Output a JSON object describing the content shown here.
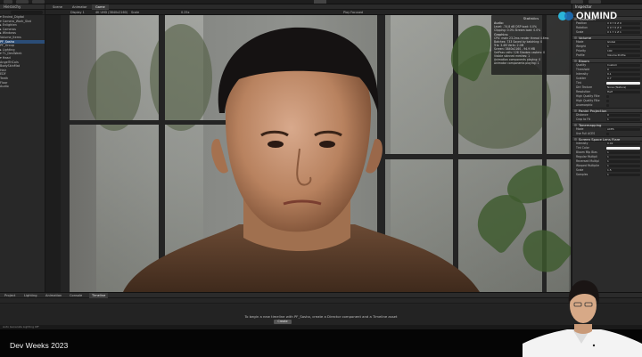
{
  "hierarchy": {
    "tab": "Hierarchy",
    "items": [
      "▾ Enviroi_Digital",
      "  ▾ Camera_Work_Stat",
      "  ▸ Enlighten",
      "  ▸ Cameras",
      "  ▸ Windows",
      "    Volume_Items",
      "    PF_Sasha",
      "    PF_Group",
      "  ▸ Lighting",
      "  ▾ TL_DevWeek",
      "    ▾ Head",
      "      AngelTriCols",
      "      BodySkinMat",
      "      Hair",
      "      EDF",
      "      Teeth",
      "    Floor",
      "    Audio"
    ]
  },
  "view_tabs": [
    "Scene",
    "Animator",
    "Game"
  ],
  "gamebar": {
    "display": "Display 1",
    "aspect": "4K UHD (3840x2160)",
    "scale": "Scale",
    "scale_value": "0.25x",
    "mode": "Play Focused"
  },
  "stats": {
    "title": "Statistics",
    "audio_h": "Audio:",
    "audio_lines": [
      "Level: -74.8 dB          DSP load: 0.0%",
      "Clipping: 0.0%             Stream load: 0.0%"
    ],
    "graphics_h": "Graphics:",
    "graphics_lines": [
      "CPU: main 23.2ms  render thread 4.6ms",
      "Batches: 733   Saved by batching: 0",
      "Tris: 3.4M    Verts: 2.0M",
      "Screen: 3840x2160 - 94.9 MB",
      "SetPass calls: 126   Shadow casters: 0",
      "Visible skinned meshes: 1",
      "Animation components playing: 0",
      "Animator components playing: 1"
    ]
  },
  "inspector": {
    "tab": "Inspector",
    "transform": {
      "title": "Transform",
      "rows": [
        {
          "label": "Position",
          "value": "X 0   Y 0   Z 0"
        },
        {
          "label": "Rotation",
          "value": "X 0   Y 0   Z 0"
        },
        {
          "label": "Scale",
          "value": "X 1   Y 1   Z 1"
        }
      ]
    },
    "volume": {
      "title": "Volume",
      "rows": [
        {
          "label": "Mode",
          "value": "Global"
        },
        {
          "label": "Weight",
          "value": "1"
        },
        {
          "label": "Priority",
          "value": "100"
        },
        {
          "label": "Profile",
          "value": "Volume Profile"
        }
      ]
    },
    "bloom": {
      "title": "Bloom",
      "rows": [
        {
          "label": "Quality",
          "value": "Custom"
        },
        {
          "label": "Threshold",
          "value": "0"
        },
        {
          "label": "Intensity",
          "value": "0.1"
        },
        {
          "label": "Scatter",
          "value": "0.7"
        },
        {
          "label": "Tint",
          "value": ""
        },
        {
          "label": "Dirt Texture",
          "value": "None (Texture)"
        },
        {
          "label": "Resolution",
          "value": "Half"
        },
        {
          "label": "High Quality Filte",
          "value": ""
        },
        {
          "label": "High Quality Filte",
          "value": ""
        },
        {
          "label": "Anamorphic",
          "value": ""
        }
      ]
    },
    "panini": {
      "title": "Panini Projection",
      "rows": [
        {
          "label": "Distance",
          "value": "0"
        },
        {
          "label": "Crop to Fit",
          "value": "1"
        }
      ]
    },
    "tonemapping": {
      "title": "Tonemapping",
      "rows": [
        {
          "label": "Mode",
          "value": "ACES"
        },
        {
          "label": "Use Full ACES",
          "value": ""
        }
      ]
    },
    "lensflare": {
      "title": "Screen Space Lens Flare",
      "rows": [
        {
          "label": "Intensity",
          "value": "0.02"
        },
        {
          "label": "Tint Color",
          "value": ""
        },
        {
          "label": "Bloom Mip Bias",
          "value": "1"
        },
        {
          "label": "Regular Multipli",
          "value": "1"
        },
        {
          "label": "Reversed Multipl",
          "value": "1"
        },
        {
          "label": "Warped Multiplie",
          "value": "1"
        },
        {
          "label": "Scale",
          "value": "1.5"
        },
        {
          "label": "Samples",
          "value": "1"
        }
      ]
    }
  },
  "bottom": {
    "tabs": [
      "Project",
      "Lighting",
      "Animation",
      "Console",
      "Timeline"
    ],
    "message": "To begin a new timeline with PF_Sasha, create a Director component and a Timeline asset",
    "create_label": "Create"
  },
  "statusbar": "Auto Generate Lighting Off",
  "event_title": "Dev Weeks 2023",
  "brand": {
    "name": "ONMIND",
    "colors": [
      "#2bb5d8",
      "#1d6fb8"
    ]
  }
}
